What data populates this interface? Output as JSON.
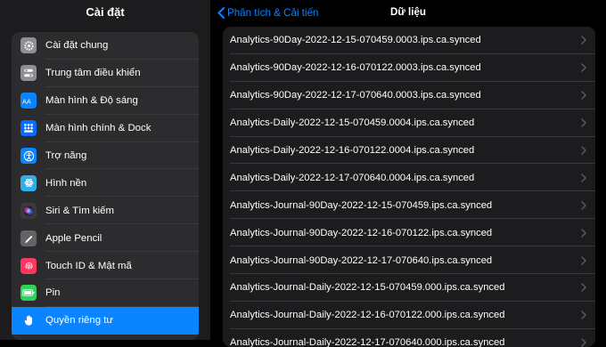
{
  "left": {
    "title": "Cài đặt",
    "items": [
      {
        "label": "Cài đặt chung",
        "icon": "gear-icon",
        "color": "#8e8e93"
      },
      {
        "label": "Trung tâm điều khiển",
        "icon": "toggle-icon",
        "color": "#8e8e93"
      },
      {
        "label": "Màn hình & Độ sáng",
        "icon": "text-size-icon",
        "color": "#0a84ff"
      },
      {
        "label": "Màn hình chính & Dock",
        "icon": "home-grid-icon",
        "color": "#0a6cff"
      },
      {
        "label": "Trợ năng",
        "icon": "accessibility-icon",
        "color": "#0a84ff"
      },
      {
        "label": "Hình nền",
        "icon": "flower-icon",
        "color": "#32ade6"
      },
      {
        "label": "Siri & Tìm kiếm",
        "icon": "siri-icon",
        "color": "#3a3a3c"
      },
      {
        "label": "Apple Pencil",
        "icon": "pencil-icon",
        "color": "#636366"
      },
      {
        "label": "Touch ID & Mật mã",
        "icon": "fingerprint-icon",
        "color": "#ff375f"
      },
      {
        "label": "Pin",
        "icon": "battery-icon",
        "color": "#30d158"
      },
      {
        "label": "Quyền riêng tư",
        "icon": "hand-icon",
        "color": "#0a84ff",
        "selected": true
      }
    ]
  },
  "nav": {
    "back_label": "Phân tích & Cải tiến",
    "title": "Dữ liệu"
  },
  "files": [
    "Analytics-90Day-2022-12-15-070459.0003.ips.ca.synced",
    "Analytics-90Day-2022-12-16-070122.0003.ips.ca.synced",
    "Analytics-90Day-2022-12-17-070640.0003.ips.ca.synced",
    "Analytics-Daily-2022-12-15-070459.0004.ips.ca.synced",
    "Analytics-Daily-2022-12-16-070122.0004.ips.ca.synced",
    "Analytics-Daily-2022-12-17-070640.0004.ips.ca.synced",
    "Analytics-Journal-90Day-2022-12-15-070459.ips.ca.synced",
    "Analytics-Journal-90Day-2022-12-16-070122.ips.ca.synced",
    "Analytics-Journal-90Day-2022-12-17-070640.ips.ca.synced",
    "Analytics-Journal-Daily-2022-12-15-070459.000.ips.ca.synced",
    "Analytics-Journal-Daily-2022-12-16-070122.000.ips.ca.synced",
    "Analytics-Journal-Daily-2022-12-17-070640.000.ips.ca.synced"
  ],
  "colors": {
    "accent": "#0a84ff",
    "sidebar_bg": "#1c1c1e",
    "group_bg": "#2c2c2e"
  }
}
